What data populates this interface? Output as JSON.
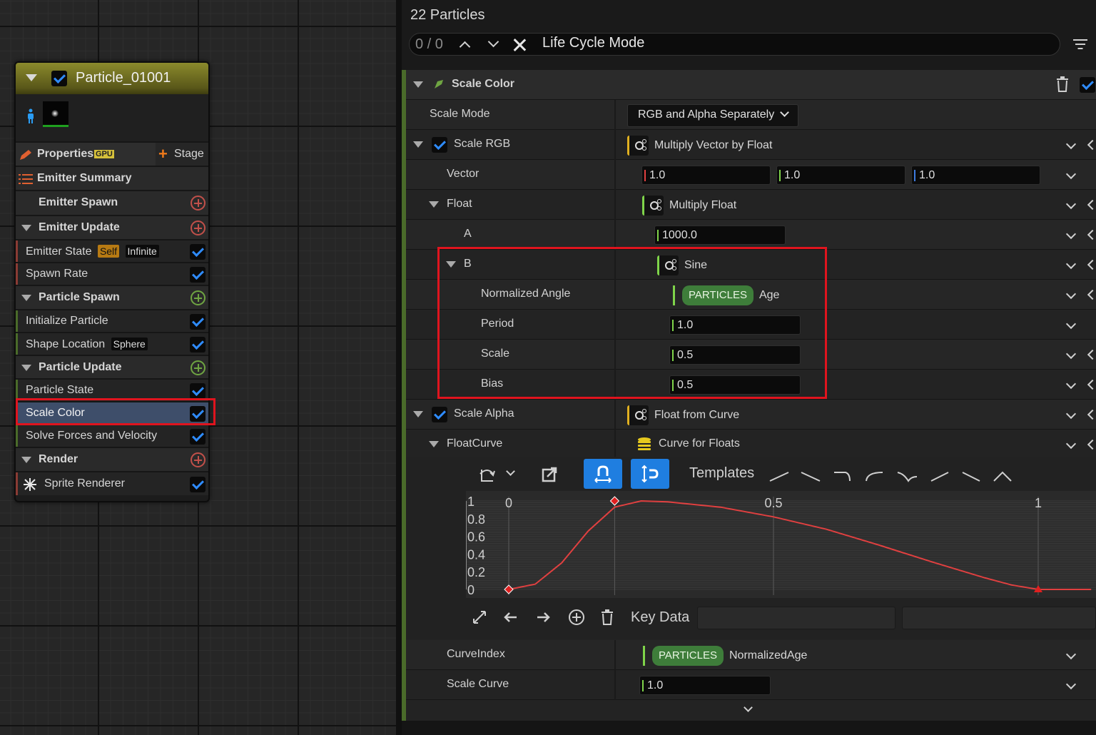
{
  "emitter": {
    "title": "Particle_01001",
    "properties_label": "Properties",
    "gpu_badge": "GPU",
    "stage_label": "Stage",
    "summary_label": "Emitter Summary",
    "rows": {
      "emitter_spawn": "Emitter Spawn",
      "emitter_update": "Emitter Update",
      "emitter_state": "Emitter State",
      "emitter_state_self": "Self",
      "emitter_state_infinite": "Infinite",
      "spawn_rate": "Spawn Rate",
      "particle_spawn": "Particle Spawn",
      "initialize_particle": "Initialize Particle",
      "shape_location": "Shape Location",
      "shape_location_sphere": "Sphere",
      "particle_update": "Particle Update",
      "particle_state": "Particle State",
      "scale_color": "Scale Color",
      "solve_forces": "Solve Forces and Velocity",
      "render": "Render",
      "sprite_renderer": "Sprite Renderer"
    }
  },
  "panel": {
    "title": "22 Particles",
    "search_count": "0 / 0",
    "search_query": "Life Cycle Mode",
    "section_title": "Scale Color",
    "scale_mode_label": "Scale Mode",
    "scale_mode_value": "RGB and Alpha Separately",
    "scale_rgb_label": "Scale RGB",
    "scale_rgb_value": "Multiply Vector by Float",
    "vector_label": "Vector",
    "vector_x": "1.0",
    "vector_y": "1.0",
    "vector_z": "1.0",
    "float_label": "Float",
    "float_value": "Multiply Float",
    "a_label": "A",
    "a_value": "1000.0",
    "b_label": "B",
    "b_value": "Sine",
    "norm_angle_label": "Normalized Angle",
    "norm_angle_ns": "PARTICLES",
    "norm_angle_attr": "Age",
    "period_label": "Period",
    "period_value": "1.0",
    "scale_label": "Scale",
    "scale_value": "0.5",
    "bias_label": "Bias",
    "bias_value": "0.5",
    "scale_alpha_label": "Scale Alpha",
    "scale_alpha_value": "Float from Curve",
    "floatcurve_label": "FloatCurve",
    "floatcurve_value": "Curve for Floats",
    "templates_label": "Templates",
    "key_data_label": "Key Data",
    "curveindex_label": "CurveIndex",
    "curveindex_ns": "PARTICLES",
    "curveindex_attr": "NormalizedAge",
    "scale_curve_label": "Scale Curve",
    "scale_curve_value": "1.0"
  },
  "chart_data": {
    "type": "line",
    "x_ticks": [
      "0",
      "0.5",
      "1"
    ],
    "y_ticks": [
      "1",
      "0.8",
      "0.6",
      "0.4",
      "0.2",
      "0"
    ],
    "xlim": [
      0,
      1
    ],
    "ylim": [
      0,
      1
    ],
    "series": [
      {
        "color": "#e04040",
        "x": [
          0,
          0.05,
          0.1,
          0.15,
          0.2,
          0.25,
          0.3,
          0.4,
          0.5,
          0.6,
          0.7,
          0.8,
          0.9,
          0.95,
          1.0,
          1.1
        ],
        "y": [
          0.0,
          0.06,
          0.3,
          0.66,
          0.93,
          1.0,
          0.99,
          0.93,
          0.82,
          0.68,
          0.5,
          0.31,
          0.13,
          0.05,
          0.0,
          0.0
        ]
      }
    ],
    "keys": [
      {
        "x": 0,
        "y": 0,
        "shape": "diamond"
      },
      {
        "x": 0.2,
        "y": 1.0,
        "shape": "diamond"
      },
      {
        "x": 1.0,
        "y": 0,
        "shape": "triangle"
      }
    ]
  }
}
